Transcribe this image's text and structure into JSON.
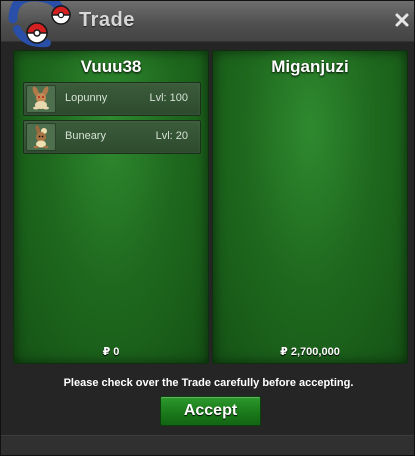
{
  "window": {
    "title": "Trade",
    "close_icon": "close-icon"
  },
  "colors": {
    "panel_green": "#1f6a1f",
    "accept_green": "#1a7a1a",
    "titlebar": "#5a5a5a",
    "text": "#ffffff"
  },
  "left_trader": {
    "name": "Vuuu38",
    "money": "₽ 0",
    "items": [
      {
        "sprite": "lopunny-sprite-icon",
        "name": "Lopunny",
        "level": "Lvl: 100"
      },
      {
        "sprite": "buneary-sprite-icon",
        "name": "Buneary",
        "level": "Lvl: 20"
      }
    ]
  },
  "right_trader": {
    "name": "Miganjuzi",
    "money": "₽ 2,700,000",
    "items": []
  },
  "notice": "Please check over the Trade carefully before accepting.",
  "accept_label": "Accept"
}
